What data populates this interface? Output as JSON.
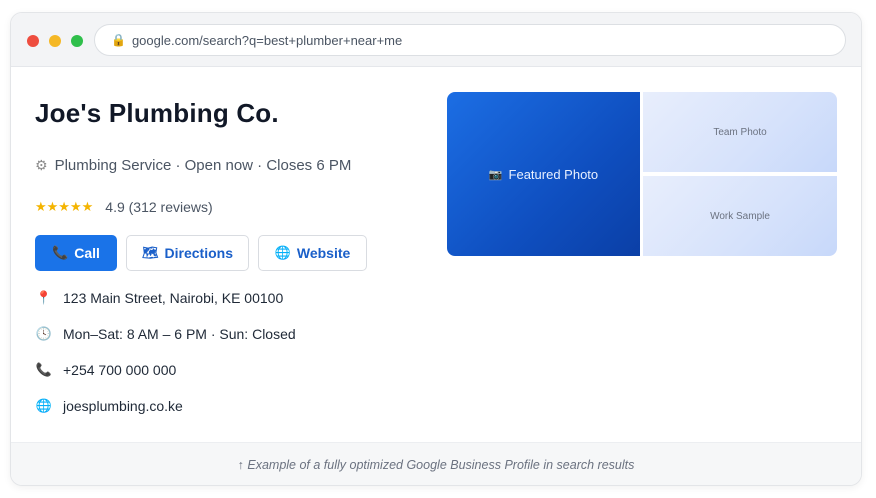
{
  "browser": {
    "url": "google.com/search?q=best+plumber+near+me"
  },
  "business": {
    "name": "Joe's Plumbing Co.",
    "category_line": "Plumbing Service · Open now · Closes 6 PM",
    "stars": "★★★★★",
    "rating_text": "4.9 (312 reviews)",
    "address": "123 Main Street, Nairobi, KE 00100",
    "hours": "Mon–Sat: 8 AM – 6 PM · Sun: Closed",
    "phone": "+254 700 000 000",
    "website": "joesplumbing.co.ke"
  },
  "actions": {
    "call_label": "Call",
    "directions_label": "Directions",
    "website_label": "Website"
  },
  "photos": {
    "featured_label": "Featured Photo",
    "team_label": "Team Photo",
    "work_label": "Work Sample"
  },
  "caption": "↑ Example of a fully optimized Google Business Profile in search results",
  "icons": {
    "lock": "lock-icon",
    "gear": "gear-icon",
    "phone": "phone-icon",
    "map": "map-icon",
    "globe": "globe-icon",
    "pin": "pin-icon",
    "clock": "clock-icon",
    "camera": "camera-icon"
  },
  "colors": {
    "accent": "#1a73e8",
    "star": "#f4b400",
    "link": "#1a5fc9"
  }
}
